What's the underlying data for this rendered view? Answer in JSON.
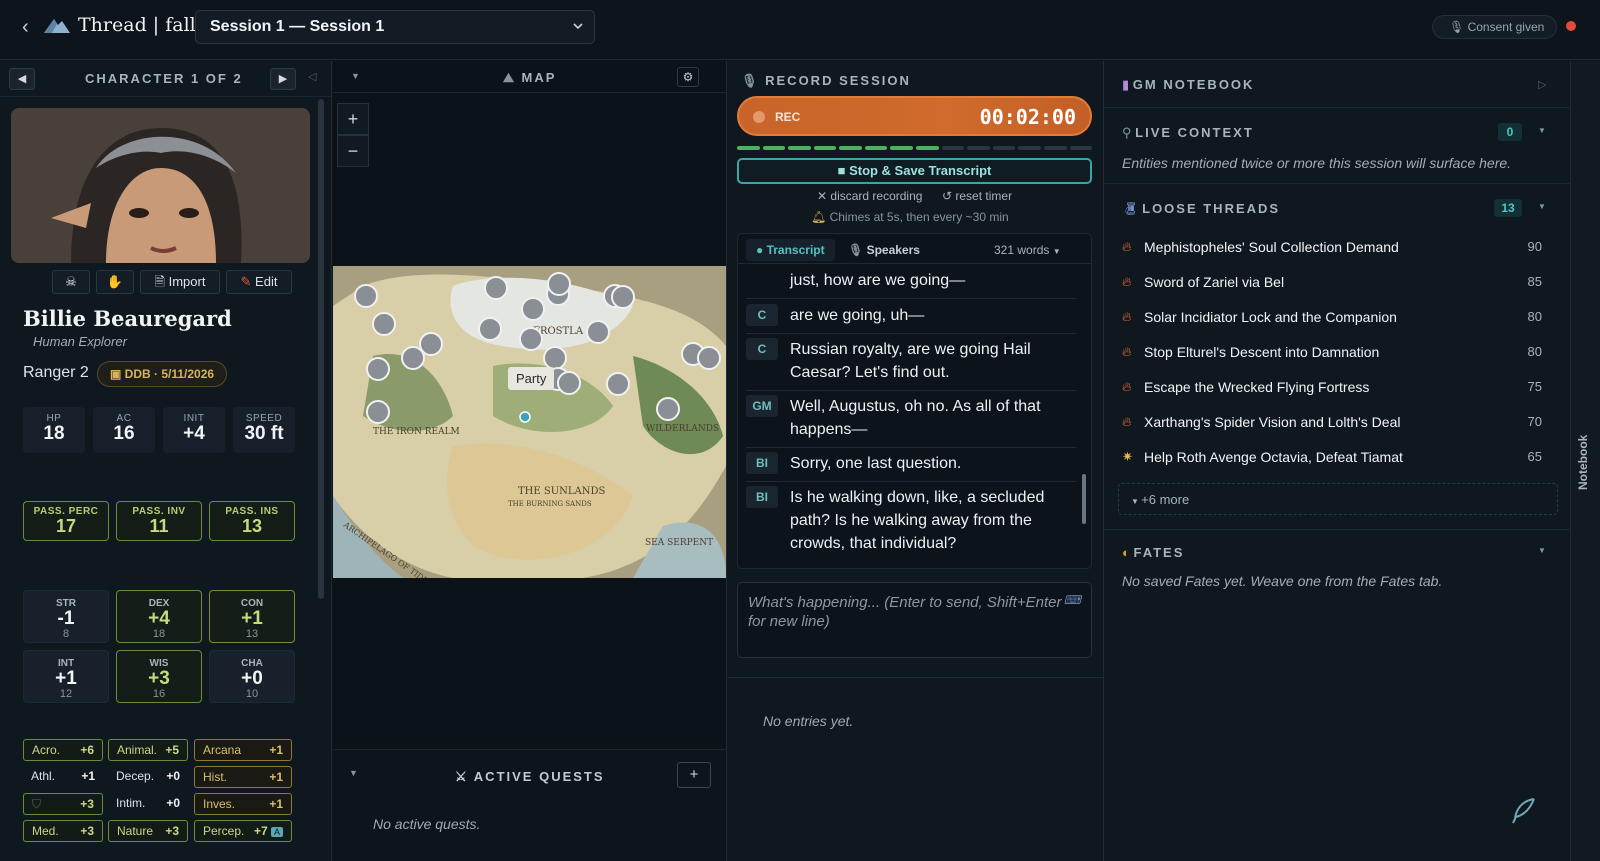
{
  "header": {
    "app_name": "Thread | fall",
    "session": "Session 1 — Session 1",
    "consent": "Consent given"
  },
  "character": {
    "nav_label": "CHARACTER 1 OF 2",
    "buttons": {
      "import": "Import",
      "edit": "Edit"
    },
    "name": "Billie Beauregard",
    "race": "Human Explorer",
    "class": "Ranger 2",
    "ddb": "DDB · 5/11/2026",
    "stats": [
      {
        "label": "HP",
        "value": "18"
      },
      {
        "label": "AC",
        "value": "16"
      },
      {
        "label": "INIT",
        "value": "+4"
      },
      {
        "label": "SPEED",
        "value": "30 ft"
      }
    ],
    "passives": [
      {
        "label": "PASS. PERC",
        "value": "17"
      },
      {
        "label": "PASS. INV",
        "value": "11"
      },
      {
        "label": "PASS. INS",
        "value": "13"
      }
    ],
    "abilities": [
      {
        "label": "STR",
        "mod": "-1",
        "score": "8"
      },
      {
        "label": "DEX",
        "mod": "+4",
        "score": "18"
      },
      {
        "label": "CON",
        "mod": "+1",
        "score": "13"
      },
      {
        "label": "INT",
        "mod": "+1",
        "score": "12"
      },
      {
        "label": "WIS",
        "mod": "+3",
        "score": "16"
      },
      {
        "label": "CHA",
        "mod": "+0",
        "score": "10"
      }
    ],
    "skills": [
      {
        "name": "Acro.",
        "mod": "+6"
      },
      {
        "name": "Animal.",
        "mod": "+5"
      },
      {
        "name": "Arcana",
        "mod": "+1"
      },
      {
        "name": "Athl.",
        "mod": "+1"
      },
      {
        "name": "Decep.",
        "mod": "+0"
      },
      {
        "name": "Hist.",
        "mod": "+1"
      },
      {
        "name": "",
        "mod": "+3"
      },
      {
        "name": "Intim.",
        "mod": "+0"
      },
      {
        "name": "Inves.",
        "mod": "+1"
      },
      {
        "name": "Med.",
        "mod": "+3"
      },
      {
        "name": "Nature",
        "mod": "+3"
      },
      {
        "name": "Percep.",
        "mod": "+7"
      }
    ],
    "expertise_badge": "A"
  },
  "map": {
    "title": "MAP",
    "party_label": "Party",
    "zoom_in": "+",
    "zoom_out": "−",
    "place_names": [
      "FROSTLA",
      "THE IRON REALM",
      "THE SUNLANDS",
      "WILDERLANDS",
      "SEA SERPENT",
      "ARCHIPELAGO OF TIDES",
      "THE BURNING SANDS"
    ]
  },
  "quests": {
    "title": "ACTIVE QUESTS",
    "add": "+",
    "empty": "No active quests."
  },
  "record": {
    "title": "RECORD SESSION",
    "rec": "REC",
    "timer": "00:02:00",
    "stop": "Stop & Save Transcript",
    "discard": "discard recording",
    "reset": "reset timer",
    "chimes": "Chimes at 5s, then every ~30 min",
    "meter_level": 0.58
  },
  "transcript": {
    "tab_transcript": "Transcript",
    "tab_speakers": "Speakers",
    "words": "321 words",
    "rows": [
      {
        "speaker": "",
        "text": "just, how are we going—"
      },
      {
        "speaker": "C",
        "text": "are we going, uh—"
      },
      {
        "speaker": "C",
        "text": "Russian royalty, are we going Hail Caesar? Let's find out."
      },
      {
        "speaker": "GM",
        "text": "Well, Augustus, oh no. As all of that happens—"
      },
      {
        "speaker": "BI",
        "text": "Sorry, one last question."
      },
      {
        "speaker": "BI",
        "text": "Is he walking down, like, a secluded path? Is he walking away from the crowds, that individual?"
      }
    ],
    "input_placeholder": "What's happening... (Enter to send, Shift+Enter for new line)",
    "no_entries": "No entries yet."
  },
  "notebook": {
    "title": "GM NOTEBOOK",
    "live_context": {
      "title": "LIVE CONTEXT",
      "count": "0",
      "hint": "Entities mentioned twice or more this session will surface here."
    },
    "loose_threads": {
      "title": "LOOSE THREADS",
      "count": "13",
      "more": "+6 more",
      "items": [
        {
          "title": "Mephistopheles' Soul Collection Demand",
          "score": "90",
          "icon": "fire-icon"
        },
        {
          "title": "Sword of Zariel via Bel",
          "score": "85",
          "icon": "fire-icon"
        },
        {
          "title": "Solar Incidiator Lock and the Companion",
          "score": "80",
          "icon": "fire-icon"
        },
        {
          "title": "Stop Elturel's Descent into Damnation",
          "score": "80",
          "icon": "fire-icon"
        },
        {
          "title": "Escape the Wrecked Flying Fortress",
          "score": "75",
          "icon": "fire-icon"
        },
        {
          "title": "Xarthang's Spider Vision and Lolth's Deal",
          "score": "70",
          "icon": "fire-icon"
        },
        {
          "title": "Help Roth Avenge Octavia, Defeat Tiamat",
          "score": "65",
          "icon": "sparkle-icon"
        }
      ]
    },
    "fates": {
      "title": "FATES",
      "empty": "No saved Fates yet. Weave one from the Fates tab."
    },
    "rail_label": "Notebook"
  }
}
